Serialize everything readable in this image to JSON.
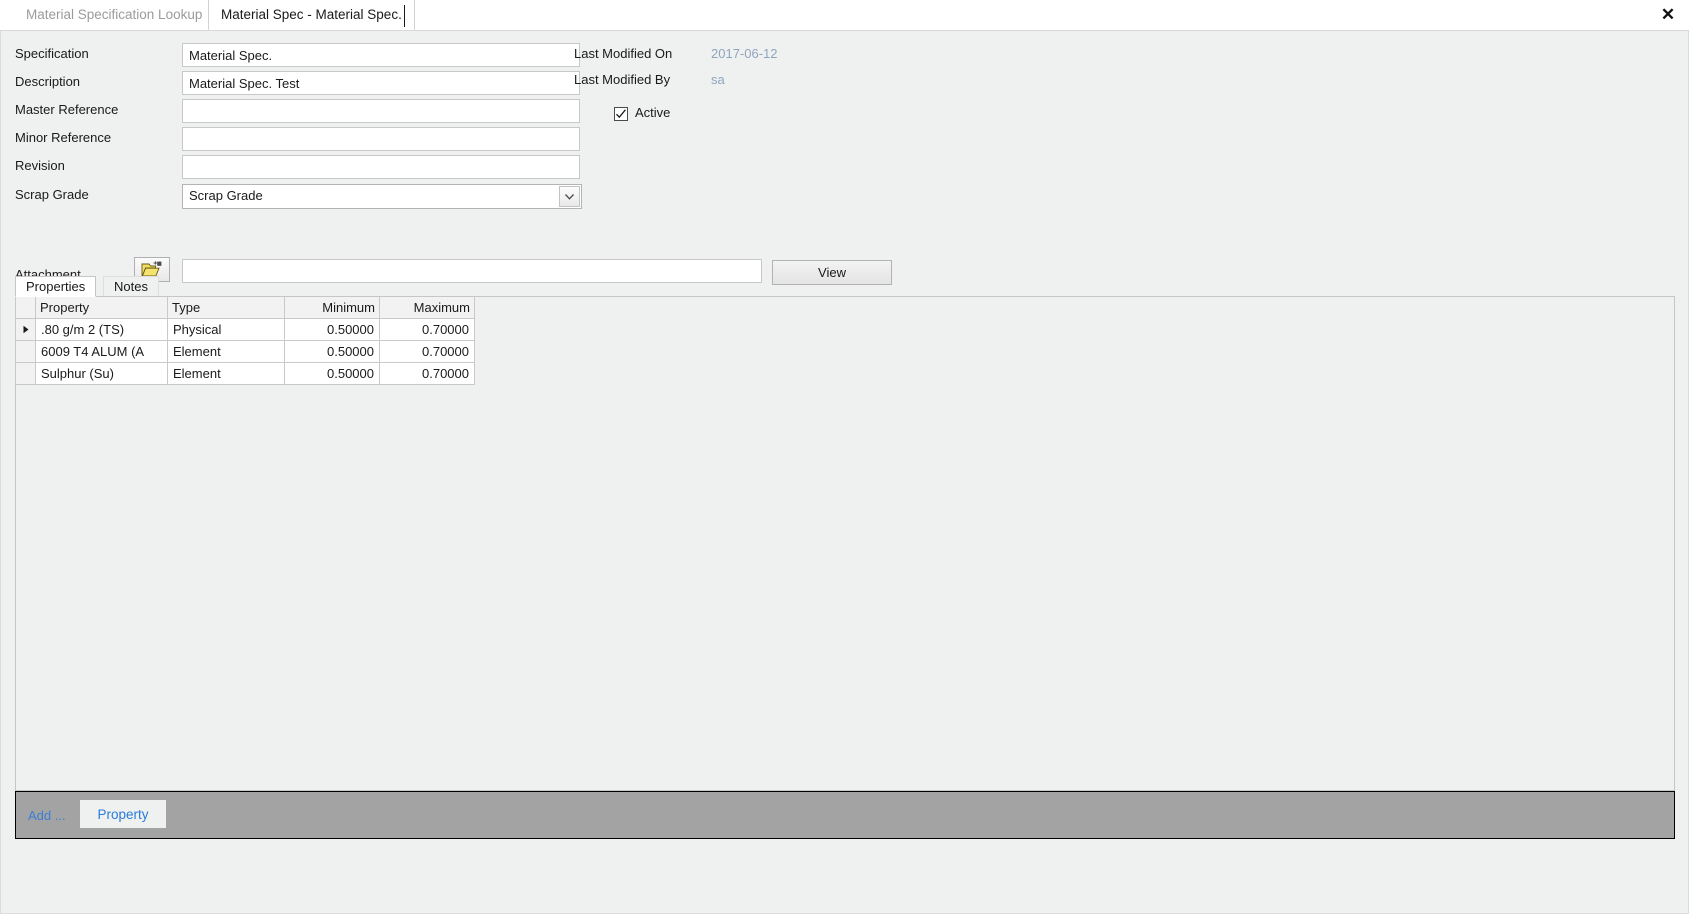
{
  "window": {
    "close_label": "✕"
  },
  "tabs": [
    {
      "label": "Material Specification Lookup",
      "active": false
    },
    {
      "label": "Material Spec - Material Spec.",
      "active": true
    }
  ],
  "form": {
    "fields": [
      {
        "label": "Specification",
        "value": "Material Spec.",
        "placeholder": ""
      },
      {
        "label": "Description",
        "value": "Material Spec. Test",
        "placeholder": ""
      },
      {
        "label": "Master Reference",
        "value": "",
        "placeholder": ""
      },
      {
        "label": "Minor Reference",
        "value": "",
        "placeholder": ""
      },
      {
        "label": "Revision",
        "value": "",
        "placeholder": ""
      }
    ],
    "scrap_grade": {
      "label": "Scrap Grade",
      "value": "Scrap Grade"
    },
    "attachment": {
      "label": "Attachment",
      "value": "",
      "placeholder": "",
      "browse_icon": "open-folder-icon",
      "view_label": "View"
    }
  },
  "meta": {
    "last_modified_on_label": "Last Modified On",
    "last_modified_on_value": "2017-06-12",
    "last_modified_by_label": "Last Modified By",
    "last_modified_by_value": "sa",
    "active_label": "Active",
    "active_checked": true
  },
  "inner_tabs": [
    {
      "label": "Properties",
      "active": true
    },
    {
      "label": "Notes",
      "active": false
    }
  ],
  "grid": {
    "columns": [
      "Property",
      "Type",
      "Minimum",
      "Maximum"
    ],
    "rows": [
      {
        "selected": true,
        "property": ".80 g/m 2 (TS)",
        "type": "Physical",
        "minimum": "0.50000",
        "maximum": "0.70000"
      },
      {
        "selected": false,
        "property": "6009 T4 ALUM (A",
        "type": "Element",
        "minimum": "0.50000",
        "maximum": "0.70000"
      },
      {
        "selected": false,
        "property": "Sulphur (Su)",
        "type": "Element",
        "minimum": "0.50000",
        "maximum": "0.70000"
      }
    ]
  },
  "action_bar": {
    "add_label": "Add ...",
    "property_label": "Property"
  },
  "colors": {
    "panel_bg": "#eff0f0",
    "meta_value": "#8fa5bd",
    "link": "#3a7fd5",
    "action_bar_bg": "#a3a3a3",
    "folder_icon": "#e8d44d"
  }
}
